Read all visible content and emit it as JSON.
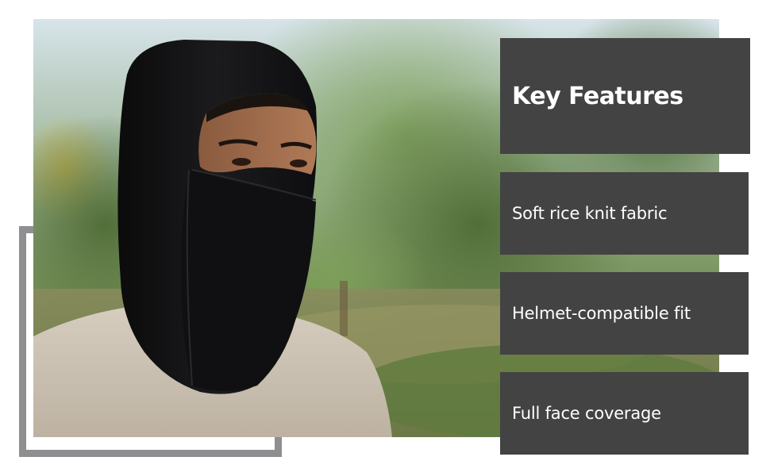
{
  "panel": {
    "heading": "Key Features",
    "features": [
      "Soft rice knit fabric",
      "Helmet-compatible fit",
      "Full face coverage"
    ]
  },
  "colors": {
    "panel_background": "#434343",
    "panel_text": "#ffffff",
    "frame": "#8f8f92",
    "page_background": "#ffffff"
  }
}
